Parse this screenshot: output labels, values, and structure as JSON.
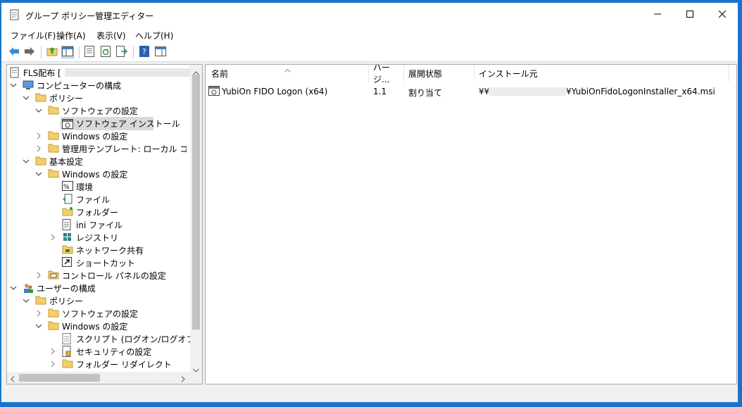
{
  "window": {
    "title": "グループ ポリシー管理エディター",
    "buttons": {
      "minimize": "minimize-icon",
      "maximize": "maximize-icon",
      "close": "close-icon"
    }
  },
  "menu": [
    "ファイル(F)",
    "操作(A)",
    "表示(V)",
    "ヘルプ(H)"
  ],
  "toolbar": [
    "back-arrow-icon",
    "forward-arrow-icon",
    "up-folder-icon",
    "show-hide-tree-icon",
    "properties-icon",
    "refresh-icon",
    "export-list-icon",
    "help-icon",
    "action-pane-icon"
  ],
  "tree": {
    "root": "FLS配布 [",
    "computer_config": "コンピューターの構成",
    "cc_policy": "ポリシー",
    "cc_software": "ソフトウェアの設定",
    "cc_software_install": "ソフトウェア インストール",
    "cc_windows": "Windows の設定",
    "cc_admin_templates": "管理用テンプレート: ローカル コンピュータ",
    "cc_preferences": "基本設定",
    "cc_pref_windows": "Windows の設定",
    "env": "環境",
    "files": "ファイル",
    "folders": "フォルダー",
    "ini_files": "ini ファイル",
    "registry": "レジストリ",
    "network_shares": "ネットワーク共有",
    "shortcuts": "ショートカット",
    "control_panel": "コントロール パネルの設定",
    "user_config": "ユーザーの構成",
    "uc_policy": "ポリシー",
    "uc_software": "ソフトウェアの設定",
    "uc_windows": "Windows の設定",
    "scripts": "スクリプト (ログオン/ログオフ)",
    "security": "セキュリティの設定",
    "folder_redirection": "フォルダー リダイレクト"
  },
  "list": {
    "columns": [
      "名前",
      "バージ...",
      "展開状態",
      "インストール元"
    ],
    "rows": [
      {
        "name": "YubiOn FIDO Logon (x64)",
        "version": "1.1",
        "state": "割り当て",
        "source_prefix": "¥¥",
        "source_suffix": "¥YubiOnFidoLogonInstaller_x64.msi"
      }
    ]
  },
  "colors": {
    "selection": "#d9d9d9",
    "accent": "#0078d7",
    "folder": "#f3cf6b",
    "desktop": "#1a73c9"
  }
}
